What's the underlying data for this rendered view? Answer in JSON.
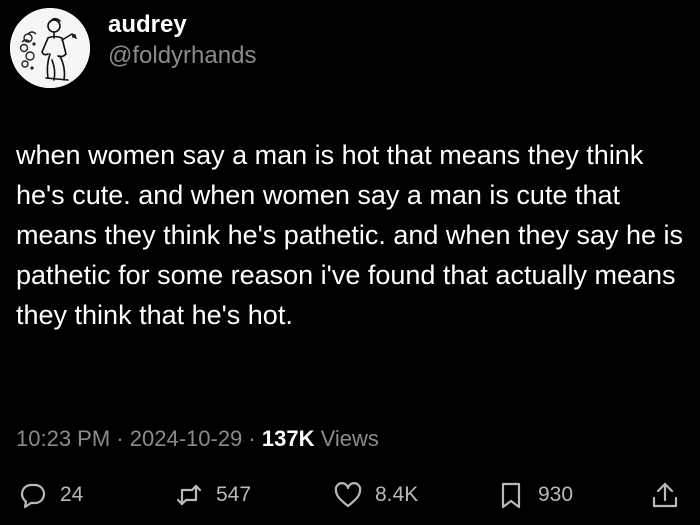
{
  "tweet": {
    "author": {
      "display_name": "audrey",
      "handle": "@foldyrhands",
      "avatar_icon": "classical-figure-illustration-avatar"
    },
    "text": "when women say a man is hot that means they think he's cute. and when women say a man is cute that means they think he's pathetic. and when they say he is pathetic for some reason i've found that actually means they think that he's hot.",
    "time": "10:23 PM",
    "separator": "·",
    "date": "2024-10-29",
    "views_count": "137K",
    "views_label": "Views"
  },
  "actions": {
    "reply": {
      "icon": "reply-icon",
      "count": "24"
    },
    "retweet": {
      "icon": "retweet-icon",
      "count": "547"
    },
    "like": {
      "icon": "heart-icon",
      "count": "8.4K"
    },
    "bookmark": {
      "icon": "bookmark-icon",
      "count": "930"
    },
    "share": {
      "icon": "share-icon"
    }
  },
  "colors": {
    "background": "#000000",
    "text": "#ffffff",
    "secondary": "#8b8b8b",
    "icon": "#b9b9b9"
  }
}
